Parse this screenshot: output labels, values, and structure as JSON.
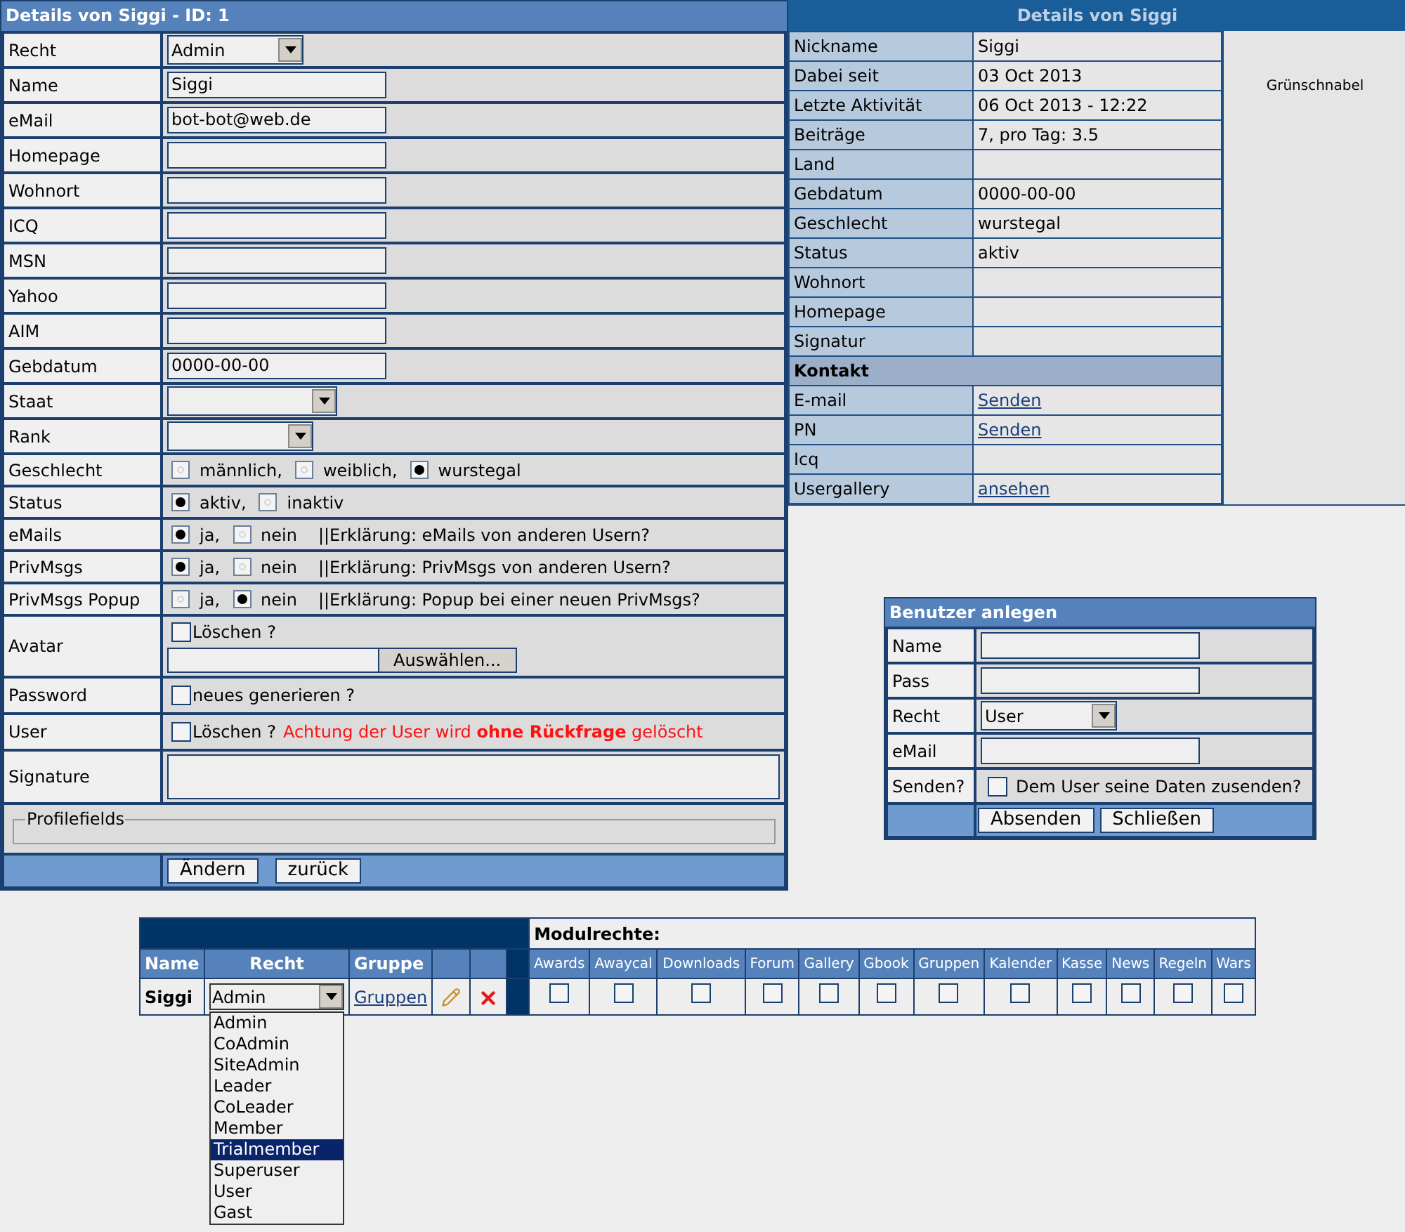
{
  "edit_form": {
    "title": "Details von Siggi - ID: 1",
    "fields": [
      {
        "kind": "select",
        "label": "Recht",
        "value": "Admin"
      },
      {
        "kind": "text",
        "label": "Name",
        "value": "Siggi"
      },
      {
        "kind": "text",
        "label": "eMail",
        "value": "bot-bot@web.de"
      },
      {
        "kind": "text",
        "label": "Homepage"
      },
      {
        "kind": "text",
        "label": "Wohnort"
      },
      {
        "kind": "text",
        "label": "ICQ"
      },
      {
        "kind": "text",
        "label": "MSN"
      },
      {
        "kind": "text",
        "label": "Yahoo"
      },
      {
        "kind": "text",
        "label": "AIM"
      },
      {
        "kind": "text",
        "label": "Gebdatum",
        "value": "0000-00-00"
      },
      {
        "kind": "select",
        "label": "Staat"
      },
      {
        "kind": "select",
        "label": "Rank"
      },
      {
        "kind": "radio",
        "label": "Geschlecht",
        "options": [
          {
            "label": "männlich,",
            "selected": false
          },
          {
            "label": "weiblich,",
            "selected": false
          },
          {
            "label": "wurstegal",
            "selected": true
          }
        ]
      },
      {
        "kind": "radio",
        "label": "Status",
        "options": [
          {
            "label": "aktiv,",
            "selected": true
          },
          {
            "label": "inaktiv",
            "selected": false
          }
        ]
      },
      {
        "kind": "radio",
        "label": "eMails",
        "options": [
          {
            "label": "ja,",
            "selected": true
          },
          {
            "label": "nein",
            "selected": false
          }
        ],
        "note": "||Erklärung: eMails von anderen Usern?"
      },
      {
        "kind": "radio",
        "label": "PrivMsgs",
        "options": [
          {
            "label": "ja,",
            "selected": true
          },
          {
            "label": "nein",
            "selected": false
          }
        ],
        "note": "||Erklärung: PrivMsgs von anderen Usern?"
      },
      {
        "kind": "radio",
        "label": "PrivMsgs Popup",
        "options": [
          {
            "label": "ja,",
            "selected": false
          },
          {
            "label": "nein",
            "selected": true
          }
        ],
        "note": "||Erklärung: Popup bei einer neuen PrivMsgs?"
      },
      {
        "kind": "avatar",
        "label": "Avatar",
        "checkbox_label": "Löschen ?",
        "checked": false,
        "button": "Auswählen..."
      },
      {
        "kind": "checkbox",
        "label": "Password",
        "checkbox_label": "neues generieren ?",
        "checked": false
      },
      {
        "kind": "checkbox",
        "label": "User",
        "checkbox_label": "Löschen ?",
        "checked": false,
        "warning": "Achtung der User wird **ohne Rückfrage** gelöscht"
      },
      {
        "kind": "textarea",
        "label": "Signature"
      }
    ],
    "fieldset": "Profilefields",
    "buttons": [
      "Ändern",
      "zurück"
    ]
  },
  "profile": {
    "title": "Details von Siggi",
    "rank_title": "Grünschnabel",
    "rows": [
      {
        "kind": "text",
        "label": "Nickname",
        "value": "Siggi"
      },
      {
        "kind": "text",
        "label": "Dabei seit",
        "value": "03 Oct 2013"
      },
      {
        "kind": "text",
        "label": "Letzte Aktivität",
        "value": "06 Oct 2013 - 12:22"
      },
      {
        "kind": "text",
        "label": "Beiträge",
        "value": "7, pro Tag: 3.5"
      },
      {
        "kind": "text",
        "label": "Land"
      },
      {
        "kind": "text",
        "label": "Gebdatum",
        "value": "0000-00-00"
      },
      {
        "kind": "text",
        "label": "Geschlecht",
        "value": "wurstegal"
      },
      {
        "kind": "text",
        "label": "Status",
        "value": "aktiv"
      },
      {
        "kind": "text",
        "label": "Wohnort"
      },
      {
        "kind": "text",
        "label": "Homepage"
      },
      {
        "kind": "text",
        "label": "Signatur"
      },
      {
        "kind": "section",
        "label": "Kontakt"
      },
      {
        "kind": "link",
        "label": "E-mail",
        "value": "Senden"
      },
      {
        "kind": "link",
        "label": "PN",
        "value": "Senden"
      },
      {
        "kind": "text",
        "label": "Icq"
      },
      {
        "kind": "link",
        "label": "Usergallery",
        "value": "ansehen"
      }
    ]
  },
  "create_user": {
    "title": "Benutzer anlegen",
    "fields": [
      {
        "kind": "text",
        "label": "Name"
      },
      {
        "kind": "text",
        "label": "Pass"
      },
      {
        "kind": "select",
        "label": "Recht",
        "value": "User"
      },
      {
        "kind": "text",
        "label": "eMail"
      },
      {
        "kind": "checkbox",
        "label": "Senden?",
        "checkbox_label": "Dem User seine Daten zusenden?",
        "checked": false
      }
    ],
    "buttons": [
      "Absenden",
      "Schließen"
    ]
  },
  "rights_table": {
    "columns": [
      "Name",
      "Recht",
      "Gruppe"
    ],
    "modules_title": "Modulrechte:",
    "modules": [
      {
        "label": "Awards",
        "checked": false
      },
      {
        "label": "Awaycal",
        "checked": false
      },
      {
        "label": "Downloads",
        "checked": false
      },
      {
        "label": "Forum",
        "checked": false
      },
      {
        "label": "Gallery",
        "checked": false
      },
      {
        "label": "Gbook",
        "checked": false
      },
      {
        "label": "Gruppen",
        "checked": false
      },
      {
        "label": "Kalender",
        "checked": false
      },
      {
        "label": "Kasse",
        "checked": false
      },
      {
        "label": "News",
        "checked": false
      },
      {
        "label": "Regeln",
        "checked": false
      },
      {
        "label": "Wars",
        "checked": false
      }
    ],
    "row": {
      "name": "Siggi",
      "recht": "Admin",
      "gruppe": "Gruppen"
    },
    "recht_options": [
      {
        "label": "Admin",
        "selected": false
      },
      {
        "label": "CoAdmin",
        "selected": false
      },
      {
        "label": "SiteAdmin",
        "selected": false
      },
      {
        "label": "Leader",
        "selected": false
      },
      {
        "label": "CoLeader",
        "selected": false
      },
      {
        "label": "Member",
        "selected": false
      },
      {
        "label": "Trialmember",
        "selected": true
      },
      {
        "label": "Superuser",
        "selected": false
      },
      {
        "label": "User",
        "selected": false
      },
      {
        "label": "Gast",
        "selected": false
      }
    ]
  }
}
